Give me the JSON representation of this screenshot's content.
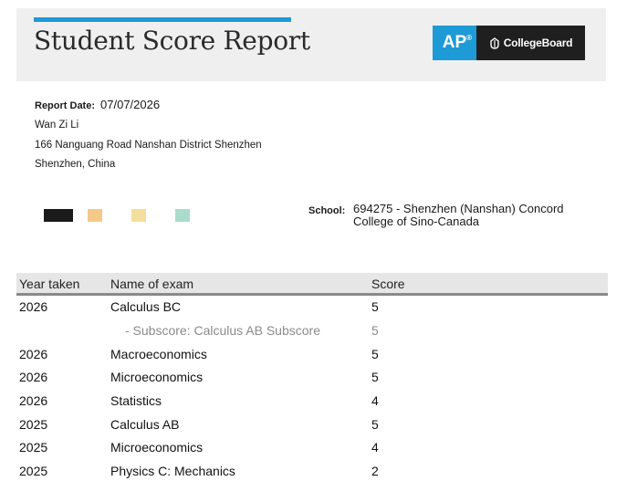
{
  "header": {
    "title": "Student Score Report",
    "logo_ap": "AP",
    "logo_ap_mark": "®",
    "logo_cb": "CollegeBoard",
    "accent_color": "#1e9ad6"
  },
  "student": {
    "report_date_label": "Report Date:",
    "report_date": "07/07/2026",
    "name": "Wan Zi Li",
    "address_line1": "166 Nanguang Road Nanshan District Shenzhen",
    "address_line2": "Shenzhen, China"
  },
  "swatches": [
    "#1a1a1a",
    "#f5c98a",
    "#f3df9d",
    "#a9dcca"
  ],
  "school": {
    "label": "School:",
    "value": "694275 - Shenzhen (Nanshan) Concord College of Sino-Canada"
  },
  "table": {
    "headers": [
      "Year taken",
      "Name of exam",
      "Score"
    ],
    "rows": [
      {
        "year": "2026",
        "exam": "Calculus BC",
        "score": "5"
      },
      {
        "year": "",
        "exam": "- Subscore: Calculus AB Subscore",
        "score": "5"
      },
      {
        "year": "2026",
        "exam": "Macroeconomics",
        "score": "5"
      },
      {
        "year": "2026",
        "exam": "Microeconomics",
        "score": "5"
      },
      {
        "year": "2026",
        "exam": "Statistics",
        "score": "4"
      },
      {
        "year": "2025",
        "exam": "Calculus AB",
        "score": "5"
      },
      {
        "year": "2025",
        "exam": "Microeconomics",
        "score": "4"
      },
      {
        "year": "2025",
        "exam": "Physics C: Mechanics",
        "score": "2"
      }
    ]
  }
}
